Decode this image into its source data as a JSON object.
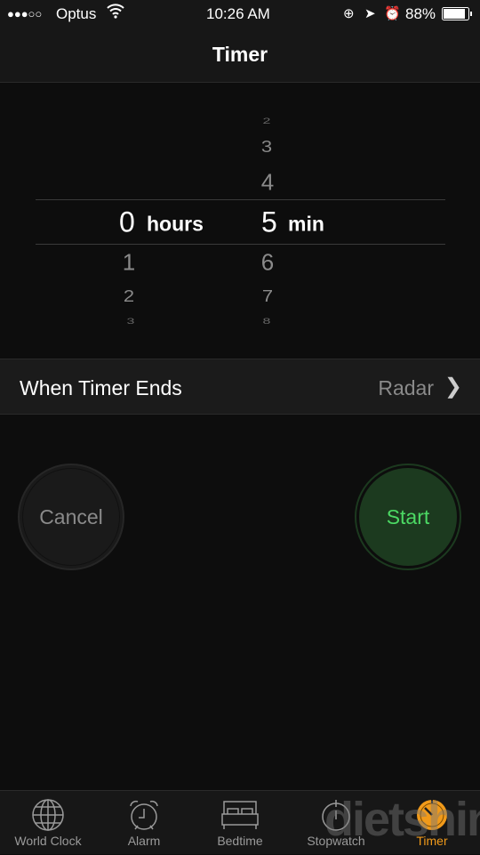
{
  "status": {
    "carrier": "Optus",
    "signal_bars": 3,
    "time": "10:26 AM",
    "battery": "88%",
    "battery_level": 0.88
  },
  "nav": {
    "title": "Timer"
  },
  "picker": {
    "hours": {
      "above": [
        "",
        ""
      ],
      "selected": "0",
      "unit": "hours",
      "below": [
        "1",
        "2",
        "3"
      ]
    },
    "minutes": {
      "above": [
        "2",
        "3",
        "4"
      ],
      "selected": "5",
      "unit": "min",
      "below": [
        "6",
        "7",
        "8"
      ]
    }
  },
  "when_ends": {
    "label": "When Timer Ends",
    "value": "Radar"
  },
  "buttons": {
    "cancel": "Cancel",
    "start": "Start"
  },
  "colors": {
    "accent": "#f19a1a",
    "start_green": "#4cd964",
    "start_bg": "#1c3a1f"
  },
  "tabs": [
    {
      "label": "World Clock",
      "icon": "globe-icon"
    },
    {
      "label": "Alarm",
      "icon": "alarm-clock-icon"
    },
    {
      "label": "Bedtime",
      "icon": "bed-icon"
    },
    {
      "label": "Stopwatch",
      "icon": "stopwatch-icon"
    },
    {
      "label": "Timer",
      "icon": "timer-icon",
      "active": true
    }
  ],
  "watermark": "dietshin.com"
}
